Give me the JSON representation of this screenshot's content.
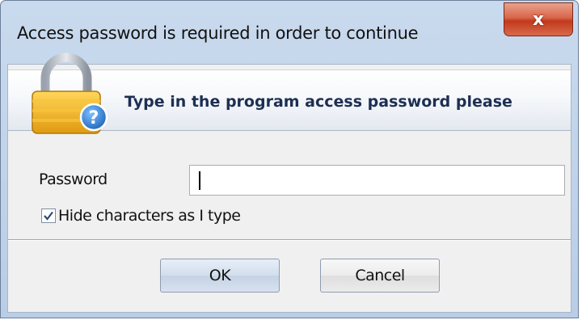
{
  "window": {
    "title": "Access password is required in order to continue",
    "close_glyph": "x"
  },
  "banner": {
    "icon": "lock-question-icon",
    "message": "Type in the program access password please"
  },
  "form": {
    "password_label": "Password",
    "password_value": "",
    "hide_characters_label": "Hide characters as I type",
    "hide_characters_checked": true
  },
  "buttons": {
    "ok_label": "OK",
    "cancel_label": "Cancel"
  },
  "colors": {
    "title_bar": "#c9daee",
    "close_button": "#c2391c",
    "banner_text": "#1d2f52",
    "lock_body": "#f2b21a",
    "question_badge": "#2f7fd0"
  }
}
